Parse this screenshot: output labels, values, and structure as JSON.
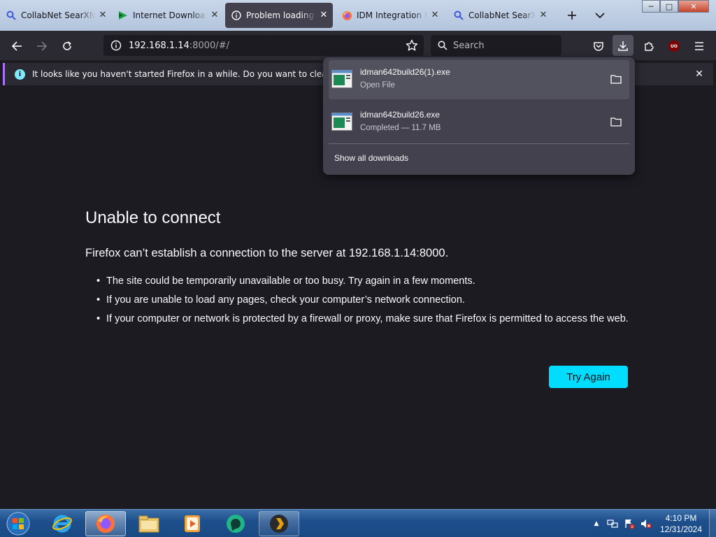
{
  "tabs": [
    {
      "label": "CollabNet SearXNG",
      "icon": "search-icon",
      "active": false
    },
    {
      "label": "Internet Download Manager",
      "icon": "idm-icon",
      "active": false
    },
    {
      "label": "Problem loading page",
      "icon": "info-icon",
      "active": true
    },
    {
      "label": "IDM Integration Module",
      "icon": "firefox-icon",
      "active": false
    },
    {
      "label": "CollabNet SearXNG",
      "icon": "search-icon",
      "active": false
    }
  ],
  "window_controls": {
    "minimize": "─",
    "maximize": "□",
    "close": "✕"
  },
  "url": {
    "host": "192.168.1.14",
    "path": ":8000/#/"
  },
  "search": {
    "placeholder": "Search"
  },
  "extension_badge": "UO",
  "notification": {
    "text": "It looks like you haven't started Firefox in a while. Do you want to clean it up for"
  },
  "downloads": {
    "items": [
      {
        "name": "idman642build26(1).exe",
        "status": "Open File"
      },
      {
        "name": "idman642build26.exe",
        "status": "Completed — 11.7 MB"
      }
    ],
    "show_all": "Show all downloads"
  },
  "error": {
    "title": "Unable to connect",
    "lead": "Firefox can’t establish a connection to the server at 192.168.1.14:8000.",
    "bullets": [
      "The site could be temporarily unavailable or too busy. Try again in a few moments.",
      "If you are unable to load any pages, check your computer’s network connection.",
      "If your computer or network is protected by a firewall or proxy, make sure that Firefox is permitted to access the web."
    ],
    "button": "Try Again"
  },
  "taskbar": {
    "time": "4:10 PM",
    "date": "12/31/2024"
  },
  "colors": {
    "accent": "#00ddff",
    "page_bg": "#1c1b22",
    "toolbar_bg": "#2b2a33",
    "panel_bg": "#42414d",
    "notification_border": "#ab71ff"
  }
}
